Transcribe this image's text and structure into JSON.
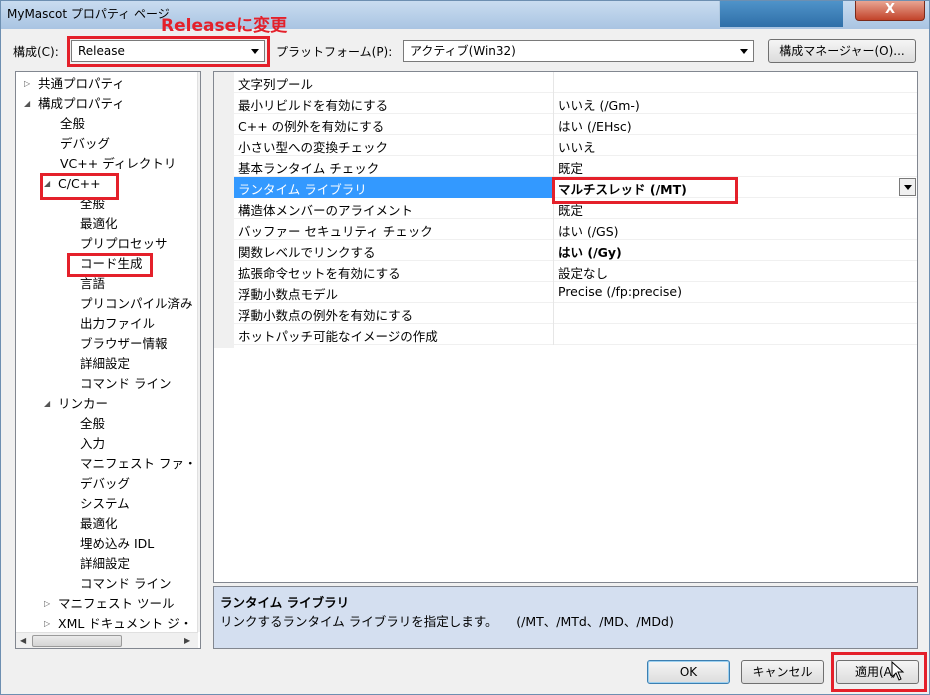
{
  "window": {
    "title": "MyMascot プロパティ ページ",
    "close_label": "X"
  },
  "annotation": {
    "text": "Releaseに変更"
  },
  "toolbar": {
    "config_label": "構成(C):",
    "config_value": "Release",
    "platform_label": "プラットフォーム(P):",
    "platform_value": "アクティブ(Win32)",
    "config_manager_label": "構成マネージャー(O)..."
  },
  "tree": [
    {
      "label": "共通プロパティ",
      "state": "closed"
    },
    {
      "label": "構成プロパティ",
      "state": "open"
    },
    {
      "label": "全般"
    },
    {
      "label": "デバッグ"
    },
    {
      "label": "VC++ ディレクトリ"
    },
    {
      "label": "C/C++",
      "state": "open"
    },
    {
      "label": "全般"
    },
    {
      "label": "最適化"
    },
    {
      "label": "プリプロセッサ"
    },
    {
      "label": "コード生成"
    },
    {
      "label": "言語"
    },
    {
      "label": "プリコンパイル済み"
    },
    {
      "label": "出力ファイル"
    },
    {
      "label": "ブラウザー情報"
    },
    {
      "label": "詳細設定"
    },
    {
      "label": "コマンド ライン"
    },
    {
      "label": "リンカー",
      "state": "open"
    },
    {
      "label": "全般"
    },
    {
      "label": "入力"
    },
    {
      "label": "マニフェスト ファ・"
    },
    {
      "label": "デバッグ"
    },
    {
      "label": "システム"
    },
    {
      "label": "最適化"
    },
    {
      "label": "埋め込み IDL"
    },
    {
      "label": "詳細設定"
    },
    {
      "label": "コマンド ライン"
    },
    {
      "label": "マニフェスト ツール",
      "state": "closed"
    },
    {
      "label": "XML ドキュメント ジ・",
      "state": "closed"
    }
  ],
  "properties": [
    {
      "name": "文字列プール",
      "value": ""
    },
    {
      "name": "最小リビルドを有効にする",
      "value": "いいえ (/Gm-)"
    },
    {
      "name": "C++ の例外を有効にする",
      "value": "はい (/EHsc)"
    },
    {
      "name": "小さい型への変換チェック",
      "value": "いいえ"
    },
    {
      "name": "基本ランタイム チェック",
      "value": "既定"
    },
    {
      "name": "ランタイム ライブラリ",
      "value": "マルチスレッド (/MT)"
    },
    {
      "name": "構造体メンバーのアライメント",
      "value": "既定"
    },
    {
      "name": "バッファー セキュリティ チェック",
      "value": "はい (/GS)"
    },
    {
      "name": "関数レベルでリンクする",
      "value": "はい (/Gy)"
    },
    {
      "name": "拡張命令セットを有効にする",
      "value": "設定なし"
    },
    {
      "name": "浮動小数点モデル",
      "value": "Precise (/fp:precise)"
    },
    {
      "name": "浮動小数点の例外を有効にする",
      "value": ""
    },
    {
      "name": "ホットパッチ可能なイメージの作成",
      "value": ""
    }
  ],
  "description": {
    "title": "ランタイム ライブラリ",
    "body": "リンクするランタイム ライブラリを指定します。　　(/MT、/MTd、/MD、/MDd)"
  },
  "buttons": {
    "ok": "OK",
    "cancel": "キャンセル",
    "apply": "適用(A)"
  },
  "colors": {
    "annotation": "#e4202a",
    "selection": "#3399ff"
  }
}
